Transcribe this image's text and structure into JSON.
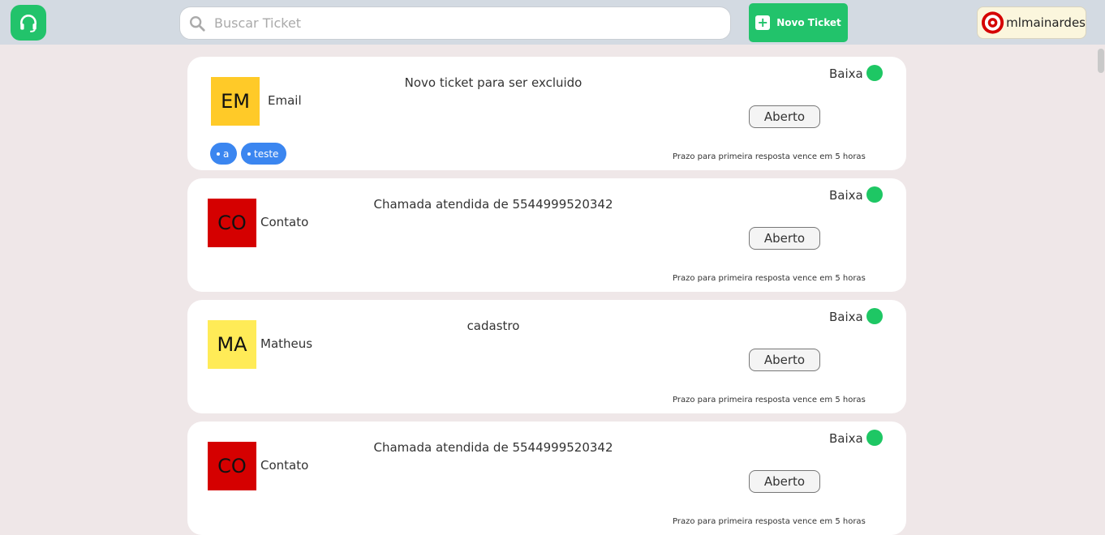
{
  "header": {
    "search_placeholder": "Buscar Ticket",
    "new_ticket_label": "Novo Ticket",
    "username": "mlmainardes"
  },
  "colors": {
    "brand": "#22c36b",
    "tag": "#3b86f0",
    "priority_low": "#1ec764"
  },
  "tickets": [
    {
      "initials": "EM",
      "avatar_color": "#ffca28",
      "contact": "Email",
      "subject": "Novo ticket para ser excluido",
      "priority": "Baixa",
      "status": "Aberto",
      "deadline": "Prazo para primeira resposta vence em 5 horas",
      "tags": [
        "a",
        "teste"
      ]
    },
    {
      "initials": "CO",
      "avatar_color": "#d50000",
      "contact": "Contato",
      "subject": "Chamada atendida de 5544999520342",
      "priority": "Baixa",
      "status": "Aberto",
      "deadline": "Prazo para primeira resposta vence em 5 horas",
      "tags": []
    },
    {
      "initials": "MA",
      "avatar_color": "#ffeb57",
      "contact": "Matheus",
      "subject": "cadastro",
      "priority": "Baixa",
      "status": "Aberto",
      "deadline": "Prazo para primeira resposta vence em 5 horas",
      "tags": []
    },
    {
      "initials": "CO",
      "avatar_color": "#d50000",
      "contact": "Contato",
      "subject": "Chamada atendida de 5544999520342",
      "priority": "Baixa",
      "status": "Aberto",
      "deadline": "Prazo para primeira resposta vence em 5 horas",
      "tags": []
    }
  ]
}
